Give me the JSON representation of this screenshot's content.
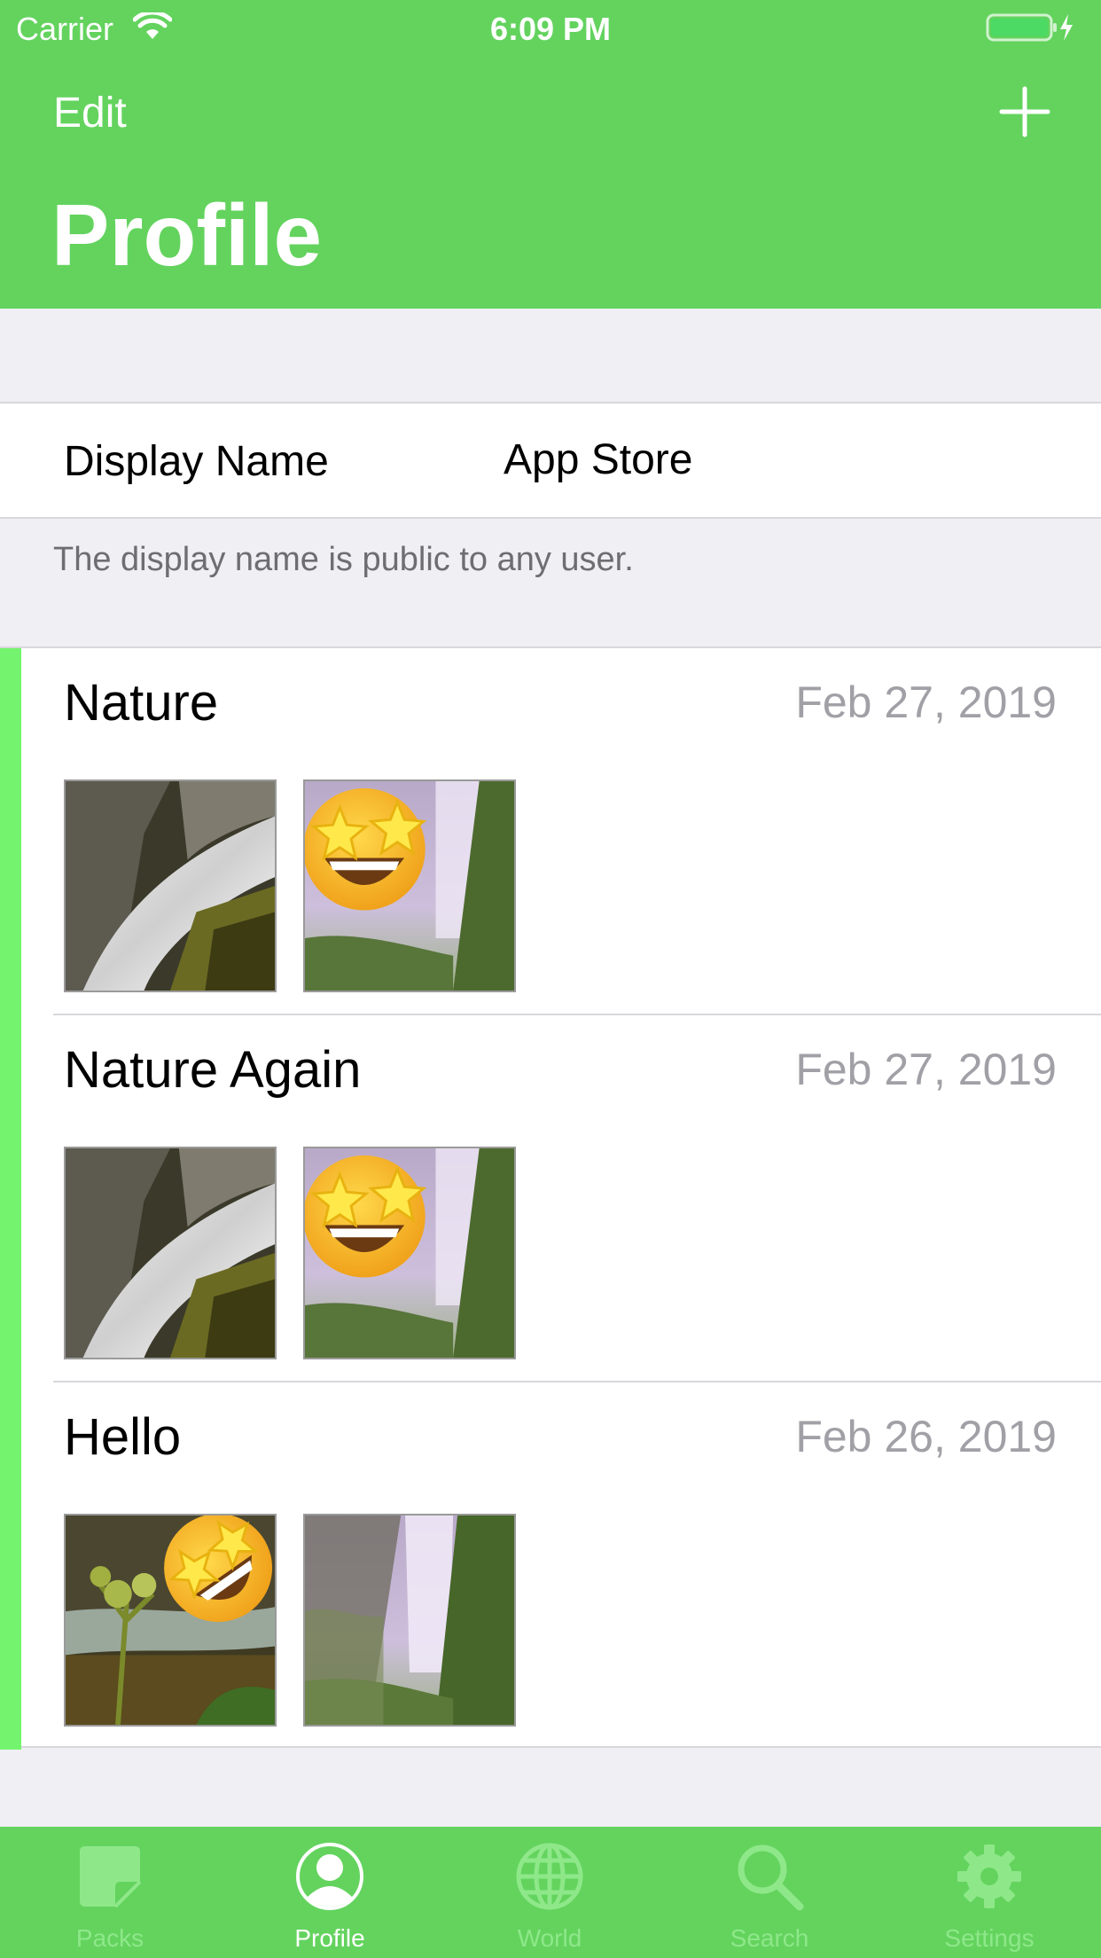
{
  "status_bar": {
    "carrier": "Carrier",
    "time": "6:09 PM"
  },
  "nav": {
    "edit_label": "Edit",
    "add_icon": "plus-icon",
    "title": "Profile"
  },
  "profile": {
    "display_name_label": "Display Name",
    "display_name_value": "App Store",
    "display_name_footer": "The display name is public to any user."
  },
  "packs": [
    {
      "name": "Nature",
      "date": "Feb 27, 2019",
      "thumbnails": [
        "waterfall-photo",
        "star-struck-emoji-on-waterfall"
      ]
    },
    {
      "name": "Nature Again",
      "date": "Feb 27, 2019",
      "thumbnails": [
        "waterfall-photo",
        "star-struck-emoji-on-waterfall"
      ]
    },
    {
      "name": "Hello",
      "date": "Feb 26, 2019",
      "thumbnails": [
        "flowers-with-tilted-emoji",
        "misty-waterfall-photo"
      ]
    }
  ],
  "tabs": [
    {
      "label": "Packs",
      "icon": "sticker-icon",
      "active": false
    },
    {
      "label": "Profile",
      "icon": "person-icon",
      "active": true
    },
    {
      "label": "World",
      "icon": "globe-icon",
      "active": false
    },
    {
      "label": "Search",
      "icon": "search-icon",
      "active": false
    },
    {
      "label": "Settings",
      "icon": "gear-icon",
      "active": false
    }
  ],
  "colors": {
    "header": "#63d35e",
    "accent": "#74f46e",
    "tab_inactive": "#8ee889",
    "date": "#a0a0a6"
  }
}
